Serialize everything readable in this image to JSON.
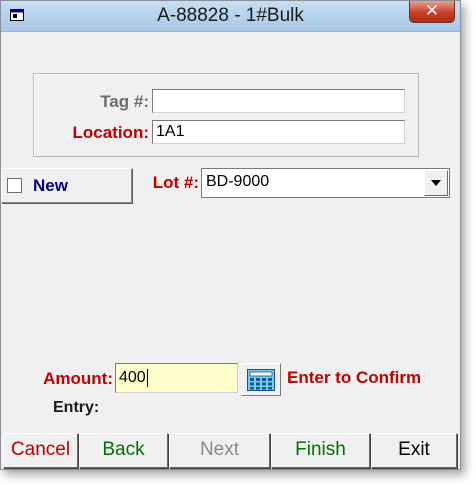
{
  "window": {
    "title": "A-88828 - 1#Bulk",
    "close_glyph": "✕"
  },
  "tag_group": {
    "tag_label": "Tag #:",
    "tag_value": "",
    "location_label": "Location:",
    "location_value": "1A1"
  },
  "new_toggle": {
    "label": "New",
    "checked": false
  },
  "lot": {
    "label": "Lot #:",
    "selected": "BD-9000"
  },
  "amount": {
    "label": "Amount:",
    "value": "400",
    "hint": "Enter to Confirm",
    "calculator_icon": "calculator-icon"
  },
  "entry": {
    "label": "Entry:"
  },
  "buttons": {
    "cancel": "Cancel",
    "back": "Back",
    "next": "Next",
    "finish": "Finish",
    "exit": "Exit"
  },
  "colors": {
    "label_red": "#c00000",
    "label_gray": "#6e6e6e",
    "navy": "#000080",
    "green": "#007000",
    "disabled": "#8a8a8a",
    "amount_bg": "#ffffcc"
  }
}
